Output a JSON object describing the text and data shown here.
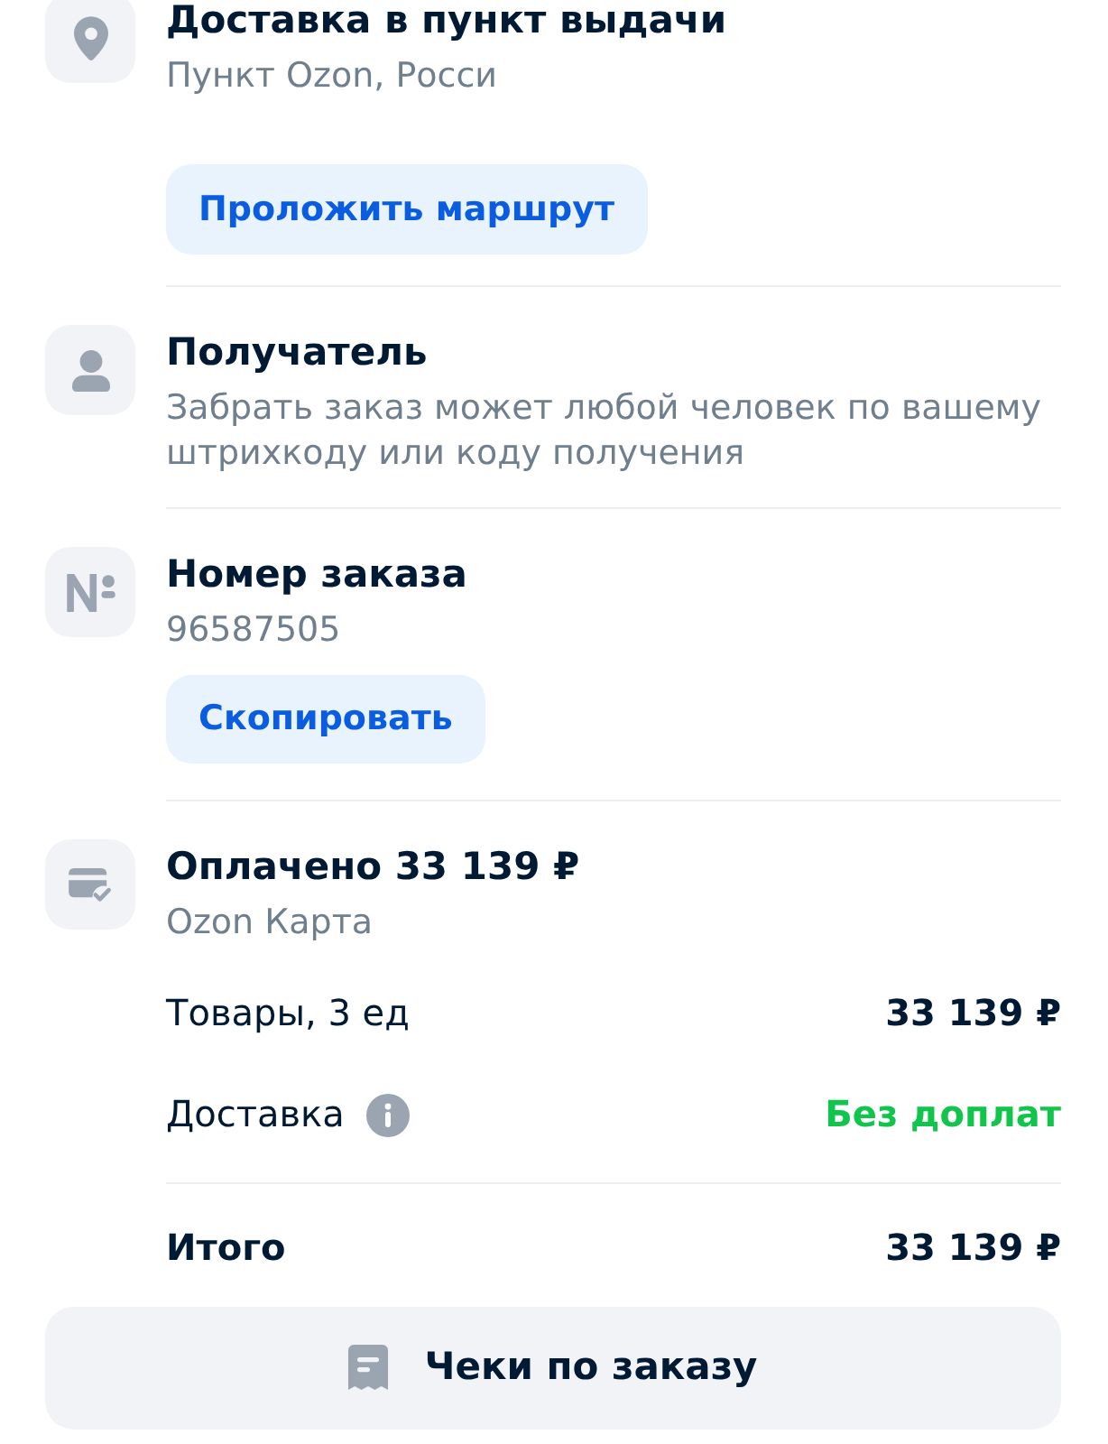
{
  "sections": [
    {
      "kind": "pickup_point",
      "title": "Доставка в пункт выдачи",
      "subtitle": "Пункт Ozon, Росси",
      "action": "Проложить маршрут"
    },
    {
      "kind": "recipient",
      "title": "Получатель",
      "subtitle": "Забрать заказ может любой человек по вашему штрихкоду или коду получения"
    },
    {
      "kind": "order_number",
      "title": "Номер заказа",
      "subtitle": "96587505",
      "action": "Скопировать"
    },
    {
      "kind": "payment",
      "title": "Оплачено 33 139 ₽",
      "subtitle": "Ozon Карта",
      "summary": [
        {
          "kind": "amount",
          "label": "Товары, 3 ед",
          "info": false,
          "value": "33 139 ₽"
        },
        {
          "kind": "free",
          "label": "Доставка",
          "info": true,
          "value": "Без доплат"
        }
      ],
      "total": {
        "label": "Итого",
        "value": "33 139 ₽"
      }
    }
  ],
  "receipts_button": "Чеки по заказу"
}
